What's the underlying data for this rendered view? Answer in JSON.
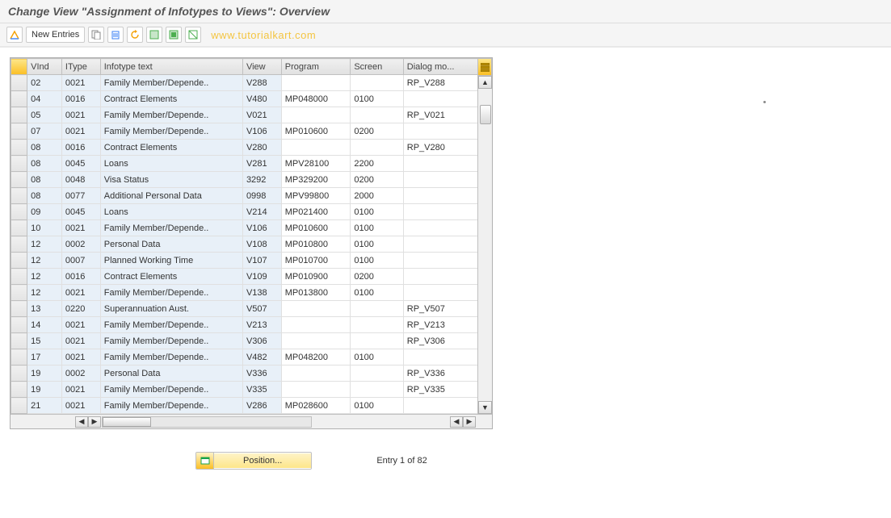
{
  "title": "Change View \"Assignment of Infotypes to Views\": Overview",
  "toolbar": {
    "new_entries": "New Entries"
  },
  "watermark": "www.tutorialkart.com",
  "columns": {
    "vind": "VInd",
    "itype": "IType",
    "text": "Infotype text",
    "view": "View",
    "program": "Program",
    "screen": "Screen",
    "dialog": "Dialog mo..."
  },
  "rows": [
    {
      "vind": "02",
      "itype": "0021",
      "text": "Family Member/Depende..",
      "view": "V288",
      "program": "",
      "screen": "",
      "dialog": "RP_V288"
    },
    {
      "vind": "04",
      "itype": "0016",
      "text": "Contract Elements",
      "view": "V480",
      "program": "MP048000",
      "screen": "0100",
      "dialog": ""
    },
    {
      "vind": "05",
      "itype": "0021",
      "text": "Family Member/Depende..",
      "view": "V021",
      "program": "",
      "screen": "",
      "dialog": "RP_V021"
    },
    {
      "vind": "07",
      "itype": "0021",
      "text": "Family Member/Depende..",
      "view": "V106",
      "program": "MP010600",
      "screen": "0200",
      "dialog": ""
    },
    {
      "vind": "08",
      "itype": "0016",
      "text": "Contract Elements",
      "view": "V280",
      "program": "",
      "screen": "",
      "dialog": "RP_V280"
    },
    {
      "vind": "08",
      "itype": "0045",
      "text": "Loans",
      "view": "V281",
      "program": "MPV28100",
      "screen": "2200",
      "dialog": ""
    },
    {
      "vind": "08",
      "itype": "0048",
      "text": "Visa Status",
      "view": "3292",
      "program": "MP329200",
      "screen": "0200",
      "dialog": ""
    },
    {
      "vind": "08",
      "itype": "0077",
      "text": "Additional Personal Data",
      "view": "0998",
      "program": "MPV99800",
      "screen": "2000",
      "dialog": ""
    },
    {
      "vind": "09",
      "itype": "0045",
      "text": "Loans",
      "view": "V214",
      "program": "MP021400",
      "screen": "0100",
      "dialog": ""
    },
    {
      "vind": "10",
      "itype": "0021",
      "text": "Family Member/Depende..",
      "view": "V106",
      "program": "MP010600",
      "screen": "0100",
      "dialog": ""
    },
    {
      "vind": "12",
      "itype": "0002",
      "text": "Personal Data",
      "view": "V108",
      "program": "MP010800",
      "screen": "0100",
      "dialog": ""
    },
    {
      "vind": "12",
      "itype": "0007",
      "text": "Planned Working Time",
      "view": "V107",
      "program": "MP010700",
      "screen": "0100",
      "dialog": ""
    },
    {
      "vind": "12",
      "itype": "0016",
      "text": "Contract Elements",
      "view": "V109",
      "program": "MP010900",
      "screen": "0200",
      "dialog": ""
    },
    {
      "vind": "12",
      "itype": "0021",
      "text": "Family Member/Depende..",
      "view": "V138",
      "program": "MP013800",
      "screen": "0100",
      "dialog": ""
    },
    {
      "vind": "13",
      "itype": "0220",
      "text": "Superannuation Aust.",
      "view": "V507",
      "program": "",
      "screen": "",
      "dialog": "RP_V507"
    },
    {
      "vind": "14",
      "itype": "0021",
      "text": "Family Member/Depende..",
      "view": "V213",
      "program": "",
      "screen": "",
      "dialog": "RP_V213"
    },
    {
      "vind": "15",
      "itype": "0021",
      "text": "Family Member/Depende..",
      "view": "V306",
      "program": "",
      "screen": "",
      "dialog": "RP_V306"
    },
    {
      "vind": "17",
      "itype": "0021",
      "text": "Family Member/Depende..",
      "view": "V482",
      "program": "MP048200",
      "screen": "0100",
      "dialog": ""
    },
    {
      "vind": "19",
      "itype": "0002",
      "text": "Personal Data",
      "view": "V336",
      "program": "",
      "screen": "",
      "dialog": "RP_V336"
    },
    {
      "vind": "19",
      "itype": "0021",
      "text": "Family Member/Depende..",
      "view": "V335",
      "program": "",
      "screen": "",
      "dialog": "RP_V335"
    },
    {
      "vind": "21",
      "itype": "0021",
      "text": "Family Member/Depende..",
      "view": "V286",
      "program": "MP028600",
      "screen": "0100",
      "dialog": ""
    }
  ],
  "footer": {
    "position": "Position...",
    "entry": "Entry 1 of 82"
  }
}
